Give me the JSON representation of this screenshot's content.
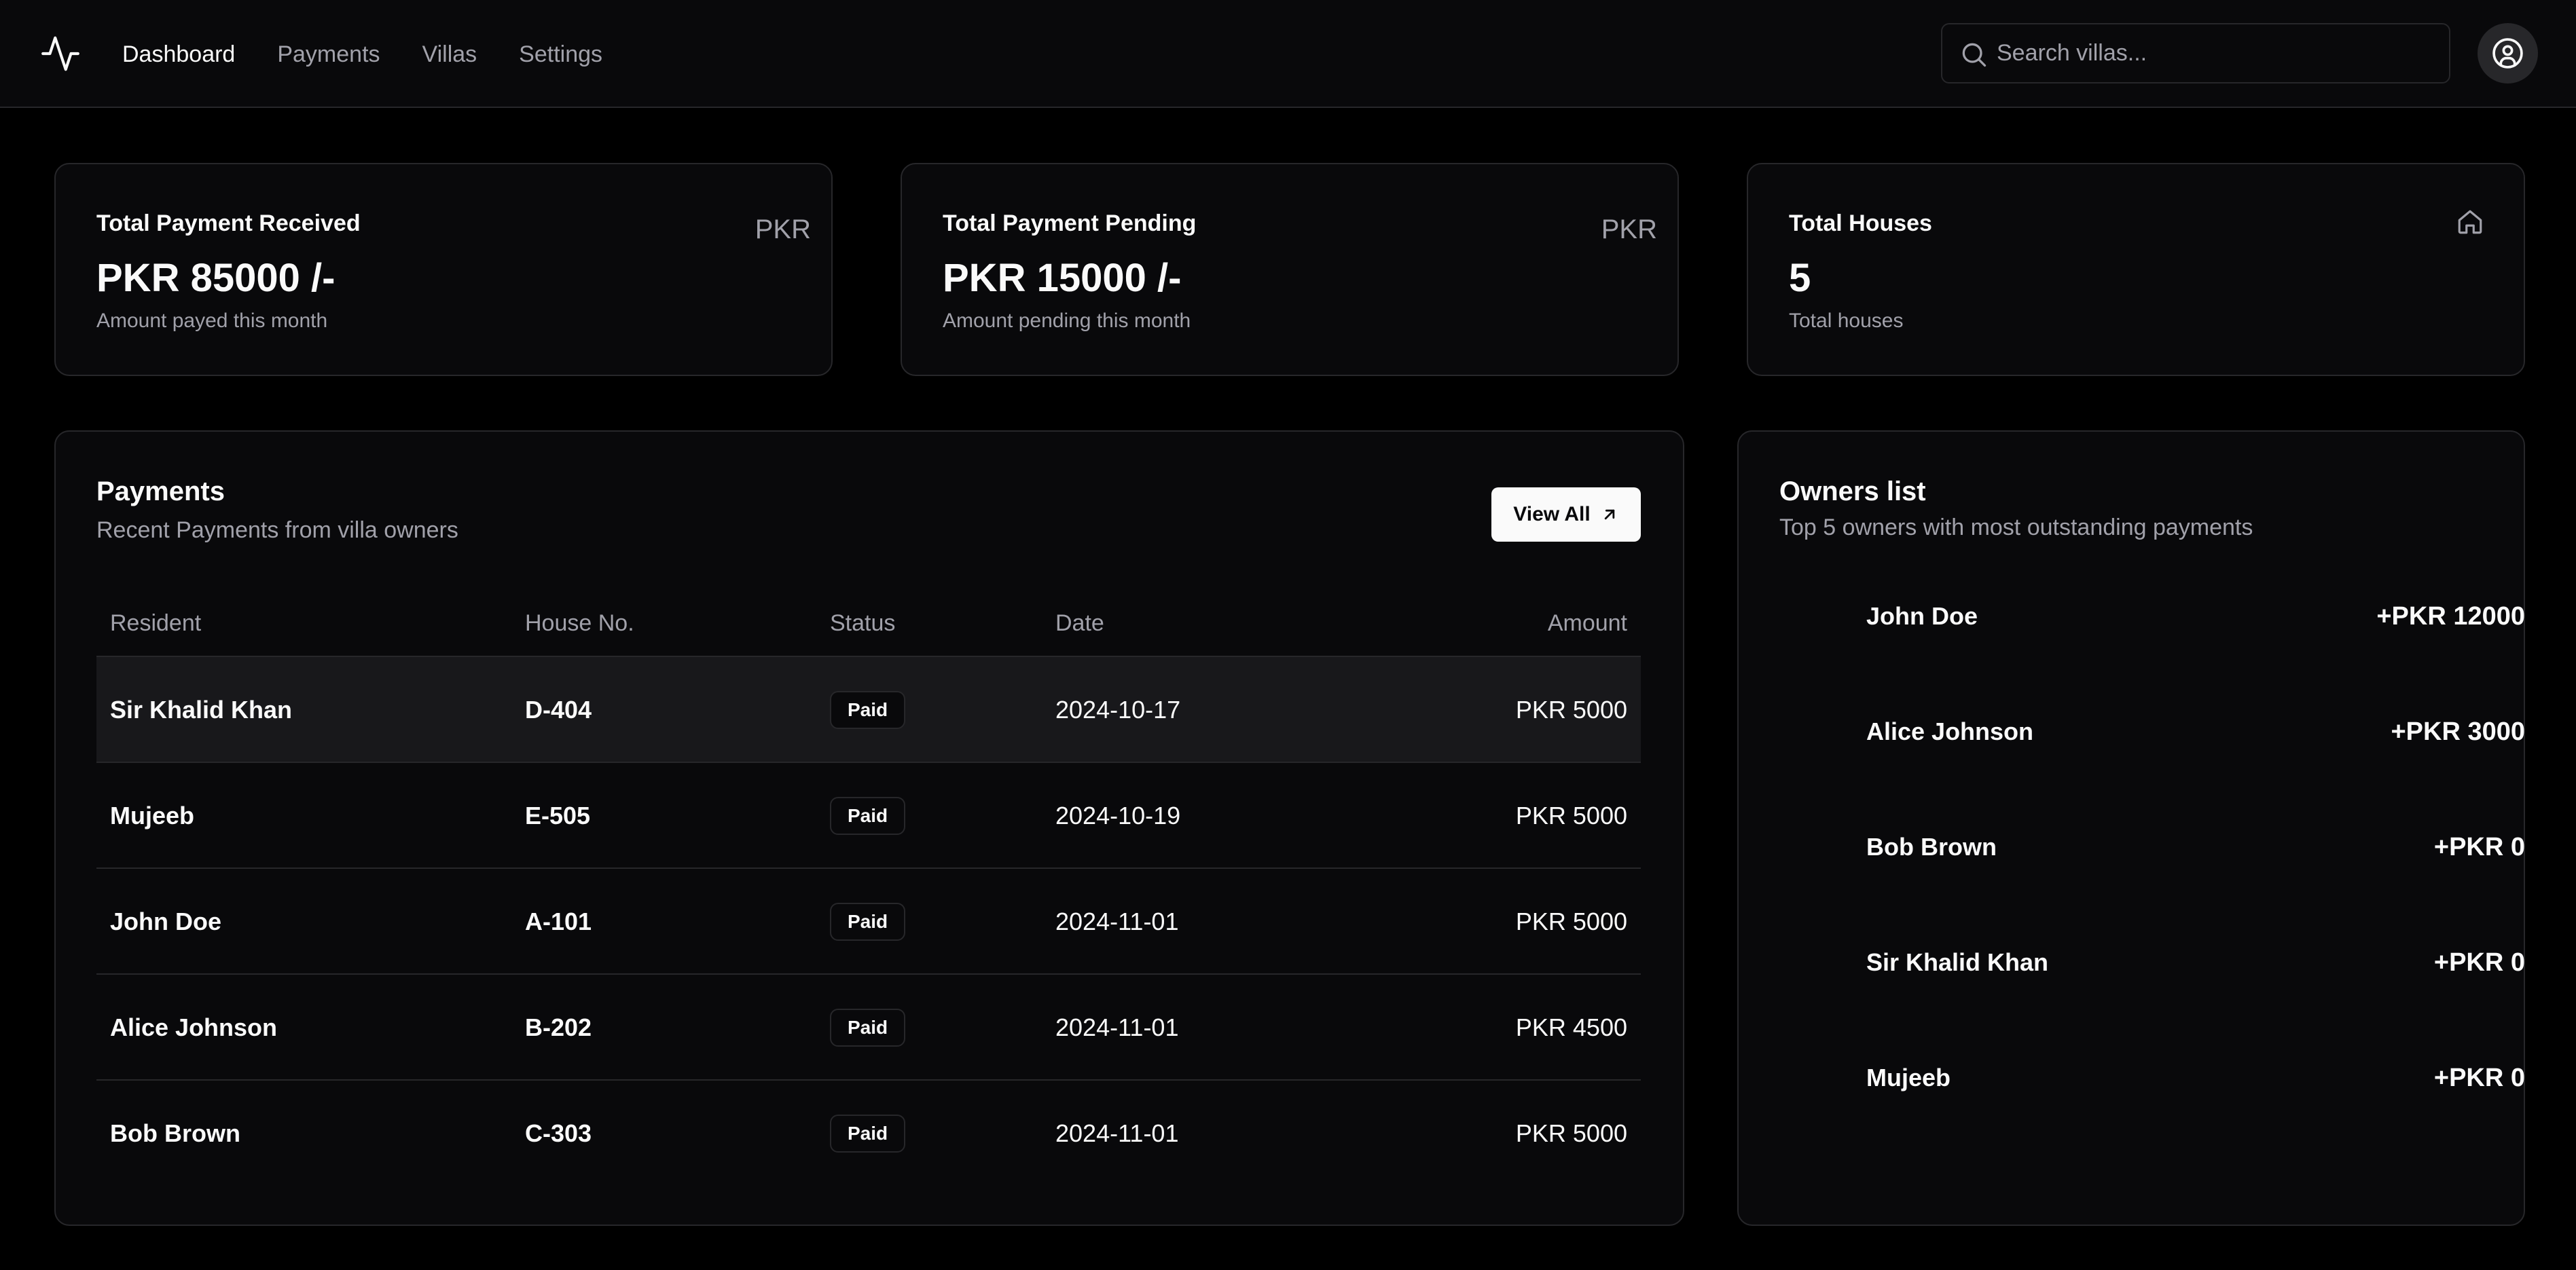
{
  "nav": {
    "items": [
      {
        "label": "Dashboard",
        "active": true
      },
      {
        "label": "Payments",
        "active": false
      },
      {
        "label": "Villas",
        "active": false
      },
      {
        "label": "Settings",
        "active": false
      }
    ]
  },
  "search": {
    "placeholder": "Search villas..."
  },
  "stats": [
    {
      "title": "Total Payment Received",
      "tag": "PKR",
      "value": "PKR 85000 /-",
      "sub": "Amount payed this month"
    },
    {
      "title": "Total Payment Pending",
      "tag": "PKR",
      "value": "PKR 15000 /-",
      "sub": "Amount pending this month"
    },
    {
      "title": "Total Houses",
      "tag_icon": "home-icon",
      "value": "5",
      "sub": "Total houses"
    }
  ],
  "payments": {
    "title": "Payments",
    "subtitle": "Recent Payments from villa owners",
    "view_all_label": "View All",
    "columns": [
      "Resident",
      "House No.",
      "Status",
      "Date",
      "Amount"
    ],
    "rows": [
      {
        "resident": "Sir Khalid Khan",
        "house": "D-404",
        "status": "Paid",
        "date": "2024-10-17",
        "amount": "PKR 5000"
      },
      {
        "resident": "Mujeeb",
        "house": "E-505",
        "status": "Paid",
        "date": "2024-10-19",
        "amount": "PKR 5000"
      },
      {
        "resident": "John Doe",
        "house": "A-101",
        "status": "Paid",
        "date": "2024-11-01",
        "amount": "PKR 5000"
      },
      {
        "resident": "Alice Johnson",
        "house": "B-202",
        "status": "Paid",
        "date": "2024-11-01",
        "amount": "PKR 4500"
      },
      {
        "resident": "Bob Brown",
        "house": "C-303",
        "status": "Paid",
        "date": "2024-11-01",
        "amount": "PKR 5000"
      }
    ]
  },
  "owners": {
    "title": "Owners list",
    "subtitle": "Top 5 owners with most outstanding payments",
    "items": [
      {
        "name": "John Doe",
        "amount": "+PKR 12000"
      },
      {
        "name": "Alice Johnson",
        "amount": "+PKR 3000"
      },
      {
        "name": "Bob Brown",
        "amount": "+PKR 0"
      },
      {
        "name": "Sir Khalid Khan",
        "amount": "+PKR 0"
      },
      {
        "name": "Mujeeb",
        "amount": "+PKR 0"
      }
    ]
  },
  "colors": {
    "background": "#000000",
    "card": "#09090b",
    "border": "#27272a",
    "muted_text": "#a1a1aa",
    "text": "#fafafa"
  }
}
